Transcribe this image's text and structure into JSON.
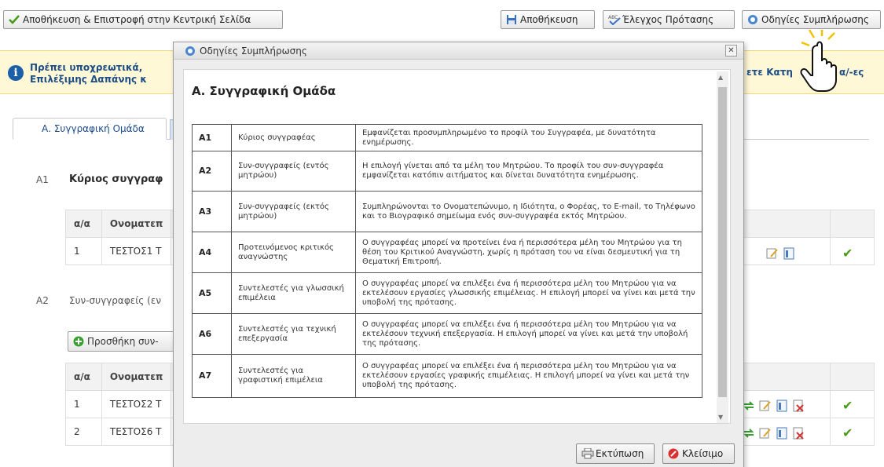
{
  "toolbar": {
    "save_return_label": "Αποθήκευση & Επιστροφή στην Κεντρική Σελίδα",
    "save_label": "Αποθήκευση",
    "spellcheck_label": "Έλεγχος Πρότασης",
    "instructions_label": "Οδηγίες Συμπλήρωσης"
  },
  "notice": {
    "line1_left": "Πρέπει υποχρεωτικά,",
    "line2_left": "Επιλέξιμης Δαπάνης κ",
    "right_text": "ετε Κατη",
    "right_suffix": "α/-ες"
  },
  "tabs": {
    "active_label": "Α. Συγγραφική Ομάδα"
  },
  "section_a1": {
    "code": "Α1",
    "title": "Κύριος συγγραφ",
    "table": {
      "headers": [
        "α/α",
        "Ονοματεπ"
      ],
      "rows": [
        {
          "num": "1",
          "name": "ΤΕΣΤΟΣ1 Τ"
        }
      ]
    }
  },
  "section_a2": {
    "code": "Α2",
    "title": "Συν-συγγραφείς (εν",
    "add_button": "Προσθήκη συν-",
    "table": {
      "headers": [
        "α/α",
        "Ονοματεπ"
      ],
      "rows": [
        {
          "num": "1",
          "name": "ΤΕΣΤΟΣ2 Τ"
        },
        {
          "num": "2",
          "name": "ΤΕΣΤΟΣ6 Τ"
        }
      ]
    }
  },
  "dialog": {
    "title": "Οδηγίες Συμπλήρωσης",
    "close_glyph": "✕",
    "heading": "Α. Συγγραφική Ομάδα",
    "rows": [
      {
        "code": "Α1",
        "name": "Κύριος συγγραφέας",
        "desc": "Εμφανίζεται προσυμπληρωμένο το προφίλ του Συγγραφέα, με δυνατότητα ενημέρωσης."
      },
      {
        "code": "Α2",
        "name": "Συν-συγγραφείς (εντός μητρώου)",
        "desc": "Η επιλογή γίνεται από τα μέλη του Μητρώου. Το προφίλ του συν-συγγραφέα εμφανίζεται κατόπιν αιτήματος και δίνεται δυνατότητα ενημέρωσης."
      },
      {
        "code": "Α3",
        "name": "Συν-συγγραφείς (εκτός μητρώου)",
        "desc": "Συμπληρώνονται το Ονοματεπώνυμο, η Ιδιότητα, ο Φορέας, το E-mail, το Τηλέφωνο και το Βιογραφικό σημείωμα ενός συν-συγγραφέα εκτός Μητρώου."
      },
      {
        "code": "Α4",
        "name": "Προτεινόμενος κριτικός αναγνώστης",
        "desc": "Ο συγγραφέας μπορεί να προτείνει ένα ή περισσότερα μέλη του Μητρώου για τη θέση του Κριτικού Αναγνώστη, χωρίς η πρόταση του να είναι δεσμευτική για τη Θεματική Επιτροπή."
      },
      {
        "code": "Α5",
        "name": "Συντελεστές για γλωσσική επιμέλεια",
        "desc": "Ο συγγραφέας μπορεί να επιλέξει ένα ή περισσότερα μέλη του Μητρώου για να εκτελέσουν εργασίες γλωσσικής επιμέλειας. Η επιλογή μπορεί να γίνει και μετά την υποβολή της πρότασης."
      },
      {
        "code": "Α6",
        "name": "Συντελεστές για τεχνική επεξεργασία",
        "desc": "Ο συγγραφέας μπορεί να επιλέξει ένα ή περισσότερα μέλη του Μητρώου για να εκτελέσουν τεχνική επεξεργασία. Η επιλογή μπορεί να γίνει και μετά την υποβολή της πρότασης."
      },
      {
        "code": "Α7",
        "name": "Συντελεστές για γραφιστική επιμέλεια",
        "desc": "Ο συγγραφέας μπορεί να επιλέξει ένα ή περισσότερα μέλη του Μητρώου για να εκτελέσουν εργασίες γραφικής επιμέλειας. Η επιλογή μπορεί να γίνει και μετά την υποβολή της πρότασης."
      }
    ],
    "print_label": "Εκτύπωση",
    "close_label": "Κλείσιμο"
  },
  "colors": {
    "accent_blue": "#1a4a8a",
    "notice_bg": "#fff8d6",
    "check_green": "#4a9a1a",
    "delete_red": "#d03030"
  },
  "icons": {
    "save_return": "check-icon",
    "save": "floppy-icon",
    "spellcheck": "spellcheck-icon",
    "instructions": "help-icon",
    "notice": "info-icon",
    "add": "plus-circle-icon",
    "print": "printer-icon",
    "close": "no-entry-icon",
    "cursor": "hand-pointer-icon"
  }
}
